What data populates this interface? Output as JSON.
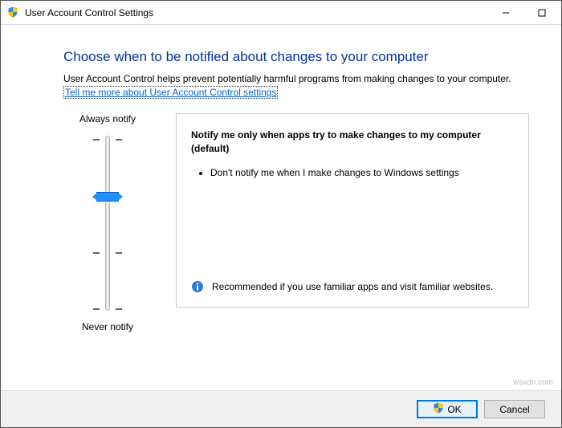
{
  "window": {
    "title": "User Account Control Settings"
  },
  "main": {
    "heading": "Choose when to be notified about changes to your computer",
    "description": "User Account Control helps prevent potentially harmful programs from making changes to your computer.",
    "link": "Tell me more about User Account Control settings"
  },
  "slider": {
    "top_label": "Always notify",
    "bottom_label": "Never notify",
    "levels": 4,
    "selected_index_from_top": 1
  },
  "detail": {
    "title": "Notify me only when apps try to make changes to my computer (default)",
    "bullet1": "Don't notify me when I make changes to Windows settings",
    "recommendation": "Recommended if you use familiar apps and visit familiar websites."
  },
  "buttons": {
    "ok": "OK",
    "cancel": "Cancel"
  },
  "watermark": "wsxdn.com"
}
